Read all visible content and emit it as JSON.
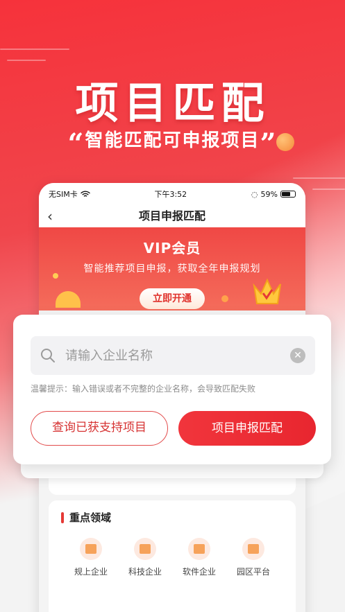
{
  "hero": {
    "title": "项目匹配",
    "subtitle": "智能匹配可申报项目",
    "open_quote": "“",
    "close_quote": "”"
  },
  "status_bar": {
    "carrier": "无SIM卡",
    "time": "下午3:52",
    "battery": "59%"
  },
  "nav": {
    "back_icon": "chevron-left-icon",
    "title": "项目申报匹配"
  },
  "vip_banner": {
    "title": "VIP会员",
    "description": "智能推荐项目申报，获取全年申报规划",
    "cta": "立即开通"
  },
  "search": {
    "placeholder": "请输入企业名称",
    "value": "",
    "tip": "温馨提示：输入错误或者不完整的企业名称，会导致匹配失败"
  },
  "actions": {
    "query": "查询已获支持项目",
    "match": "项目申报匹配"
  },
  "key_areas": {
    "title": "重点领域",
    "items": [
      {
        "label": "规上企业",
        "icon": "building-icon"
      },
      {
        "label": "科技企业",
        "icon": "document-icon"
      },
      {
        "label": "软件企业",
        "icon": "code-window-icon"
      },
      {
        "label": "园区平台",
        "icon": "chart-board-icon"
      }
    ]
  },
  "colors": {
    "primary": "#e8262f",
    "accent": "#f6a25a"
  }
}
